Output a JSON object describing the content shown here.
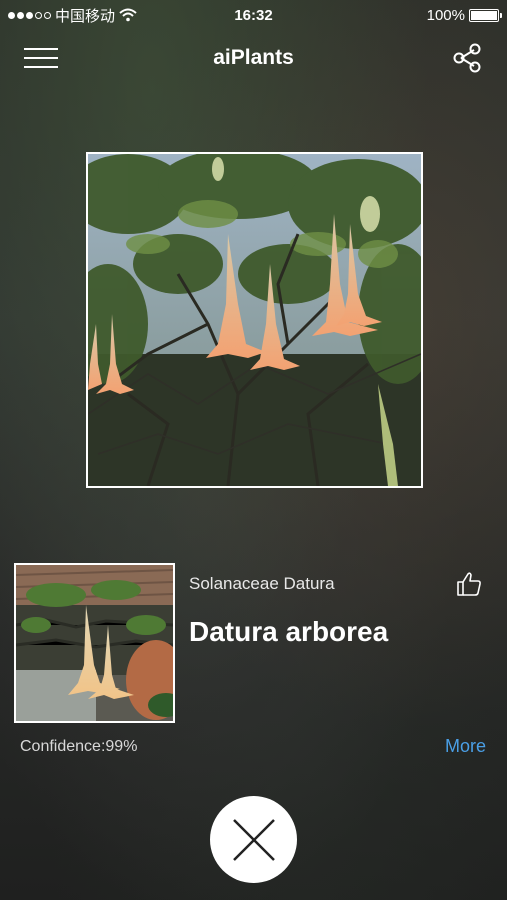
{
  "status_bar": {
    "carrier": "中国移动",
    "time": "16:32",
    "battery": "100%",
    "battery_level": 1.0
  },
  "nav": {
    "title": "aiPlants",
    "menu_icon": "hamburger-menu-icon",
    "share_icon": "share-icon"
  },
  "result": {
    "family": "Solanaceae Datura",
    "species": "Datura arborea",
    "confidence": "Confidence:99%",
    "more_label": "More",
    "like_icon": "thumbs-up-icon"
  },
  "close_icon": "close-icon",
  "colors": {
    "link": "#4a9fe6",
    "flower": "#f0a77a"
  }
}
